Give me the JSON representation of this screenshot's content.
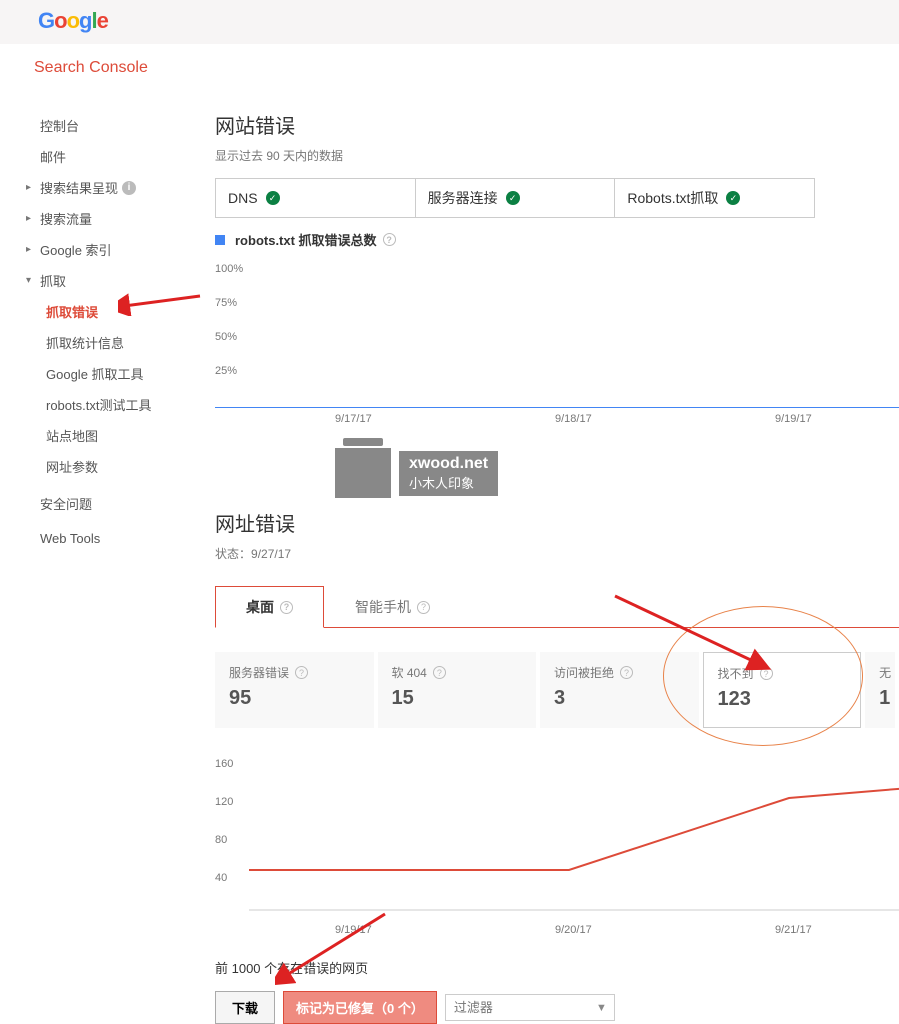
{
  "header": {
    "logo_letters": [
      "G",
      "o",
      "o",
      "g",
      "l",
      "e"
    ],
    "console_title": "Search Console"
  },
  "sidebar": {
    "items": [
      {
        "label": "控制台",
        "type": "plain"
      },
      {
        "label": "邮件",
        "type": "plain"
      },
      {
        "label": "搜索结果呈现",
        "type": "expand",
        "info": true
      },
      {
        "label": "搜索流量",
        "type": "expand"
      },
      {
        "label": "Google 索引",
        "type": "expand"
      },
      {
        "label": "抓取",
        "type": "expanded"
      },
      {
        "label": "抓取错误",
        "type": "sub",
        "active": true
      },
      {
        "label": "抓取统计信息",
        "type": "sub"
      },
      {
        "label": "Google 抓取工具",
        "type": "sub"
      },
      {
        "label": "robots.txt测试工具",
        "type": "sub"
      },
      {
        "label": "站点地图",
        "type": "sub"
      },
      {
        "label": "网址参数",
        "type": "sub"
      },
      {
        "label": "安全问题",
        "type": "plain"
      },
      {
        "label": "Web Tools",
        "type": "plain"
      }
    ]
  },
  "section1": {
    "title": "网站错误",
    "subtitle": "显示过去 90 天内的数据",
    "tabs": [
      {
        "label": "DNS"
      },
      {
        "label": "服务器连接"
      },
      {
        "label": "Robots.txt抓取"
      }
    ],
    "legend": "robots.txt 抓取错误总数"
  },
  "chart_data": [
    {
      "type": "line",
      "title": "robots.txt 抓取错误总数",
      "y_ticks": [
        "100%",
        "75%",
        "50%",
        "25%"
      ],
      "x_ticks": [
        "9/17/17",
        "9/18/17",
        "9/19/17"
      ],
      "ylim": [
        0,
        100
      ],
      "series": [
        {
          "name": "robots.txt 抓取错误总数",
          "values": [
            0,
            0,
            0
          ]
        }
      ]
    },
    {
      "type": "line",
      "title": "找不到",
      "y_ticks": [
        "160",
        "120",
        "80",
        "40"
      ],
      "x_ticks": [
        "9/19/17",
        "9/20/17",
        "9/21/17"
      ],
      "ylim": [
        0,
        160
      ],
      "x": [
        "9/19/17",
        "9/20/17",
        "9/21/17"
      ],
      "series": [
        {
          "name": "找不到",
          "values": [
            50,
            50,
            120
          ],
          "color": "#dd4b39"
        }
      ]
    }
  ],
  "watermark": {
    "line1": "xwood.net",
    "line2": "小木人印象"
  },
  "section2": {
    "title": "网址错误",
    "status_prefix": "状态：",
    "status_date": "9/27/17",
    "tabs": [
      {
        "label": "桌面",
        "active": true
      },
      {
        "label": "智能手机"
      }
    ],
    "cards": [
      {
        "label": "服务器错误",
        "value": "95"
      },
      {
        "label": "软 404",
        "value": "15"
      },
      {
        "label": "访问被拒绝",
        "value": "3"
      },
      {
        "label": "找不到",
        "value": "123",
        "highlight": true
      },
      {
        "label": "无",
        "value": "1"
      }
    ]
  },
  "footer": {
    "title": "前 1000 个存在错误的网页",
    "download": "下载",
    "mark_fixed": "标记为已修复（0 个）",
    "filter_placeholder": "过滤器"
  }
}
